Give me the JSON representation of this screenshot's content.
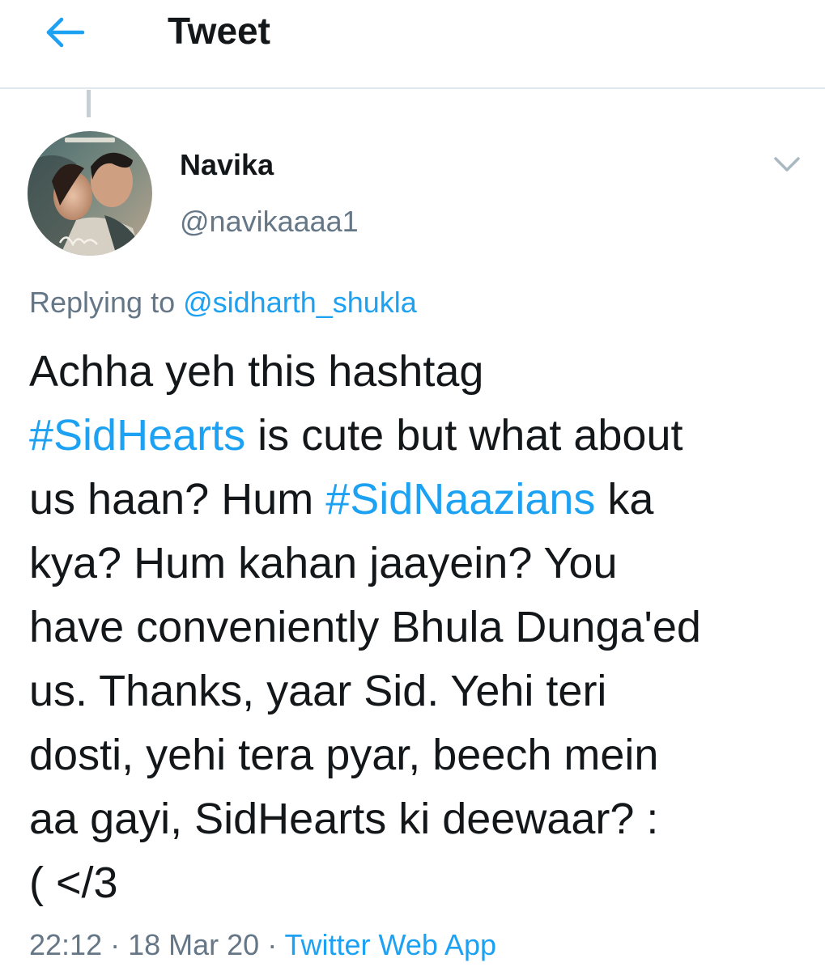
{
  "header": {
    "back_icon": "arrow-left-icon",
    "title": "Tweet"
  },
  "colors": {
    "accent": "#1da1f2",
    "text_primary": "#14171a",
    "text_secondary": "#657786",
    "divider": "#e1e8ed"
  },
  "tweet": {
    "author": {
      "display_name": "Navika",
      "handle": "@navikaaaa1",
      "avatar_icon": "user-avatar"
    },
    "menu_icon": "chevron-down-icon",
    "replying_prefix": "Replying to ",
    "replying_to": "@sidharth_shukla",
    "lines": [
      [
        {
          "text": "Achha yeh this hashtag"
        }
      ],
      [
        {
          "text": "#SidHearts",
          "link": true
        },
        {
          "text": " is cute but what about"
        }
      ],
      [
        {
          "text": "us haan? Hum "
        },
        {
          "text": "#SidNaazians",
          "link": true
        },
        {
          "text": " ka"
        }
      ],
      [
        {
          "text": "kya? Hum kahan jaayein? You"
        }
      ],
      [
        {
          "text": "have conveniently Bhula Dunga'ed"
        }
      ],
      [
        {
          "text": "us. Thanks, yaar Sid. Yehi teri"
        }
      ],
      [
        {
          "text": "dosti, yehi tera pyar, beech mein"
        }
      ],
      [
        {
          "text": "aa gayi, SidHearts ki deewaar? :"
        }
      ],
      [
        {
          "text": "( </3"
        }
      ]
    ],
    "time": "22:12",
    "separator": " · ",
    "date": "18 Mar 20",
    "source": "Twitter Web App"
  }
}
